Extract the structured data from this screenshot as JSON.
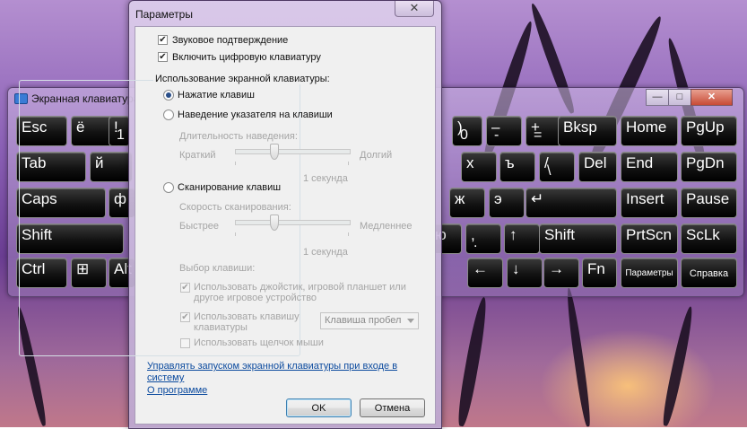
{
  "osk": {
    "title": "Экранная клавиатура",
    "title_buttons": {
      "minimize": "—",
      "maximize": "□",
      "close": "✕"
    },
    "rows": [
      [
        {
          "label": "Esc"
        },
        {
          "label": "ё"
        },
        {
          "label": "!",
          "sub": "1"
        },
        {
          "label": ")",
          "sub": "0"
        },
        {
          "label": "–",
          "sub": "-"
        },
        {
          "label": "+",
          "sub": "="
        },
        {
          "label": "Bksp"
        },
        {
          "label": "Home"
        },
        {
          "label": "PgUp"
        }
      ],
      [
        {
          "label": "Tab"
        },
        {
          "label": "й"
        },
        {
          "label": "х"
        },
        {
          "label": "ъ"
        },
        {
          "label": "/",
          "sub": "\\"
        },
        {
          "label": "Del"
        },
        {
          "label": "End"
        },
        {
          "label": "PgDn"
        }
      ],
      [
        {
          "label": "Caps"
        },
        {
          "label": "ф"
        },
        {
          "label": "ж"
        },
        {
          "label": "э"
        },
        {
          "label": "↵"
        },
        {
          "label": "Insert"
        },
        {
          "label": "Pause"
        }
      ],
      [
        {
          "label": "Shift"
        },
        {
          "label": "ю"
        },
        {
          "label": ",",
          "sub": "."
        },
        {
          "label": "↑"
        },
        {
          "label": "Shift"
        },
        {
          "label": "PrtScn"
        },
        {
          "label": "ScLk"
        }
      ],
      [
        {
          "label": "Ctrl"
        },
        {
          "label": "⊞"
        },
        {
          "label": "Alt"
        },
        {
          "label": "←"
        },
        {
          "label": "↓"
        },
        {
          "label": "→"
        },
        {
          "label": "Fn"
        },
        {
          "label": "Параметры"
        },
        {
          "label": "Справка"
        }
      ]
    ]
  },
  "dialog": {
    "title": "Параметры",
    "close": "✕",
    "sound_confirm": "Звуковое подтверждение",
    "numpad": "Включить цифровую клавиатуру",
    "group_title": "Использование экранной клавиатуры:",
    "mode_click": "Нажатие клавиш",
    "mode_hover": "Наведение указателя на клавиши",
    "hover_duration_label": "Длительность наведения:",
    "hover_short": "Краткий",
    "hover_long": "Долгий",
    "hover_value": "1 секунда",
    "mode_scan": "Сканирование клавиш",
    "scan_speed_label": "Скорость сканирования:",
    "scan_fast": "Быстрее",
    "scan_slow": "Медленнее",
    "scan_value": "1 секунда",
    "key_select_label": "Выбор клавиши:",
    "use_joystick_1": "Использовать джойстик, игровой планшет или",
    "use_joystick_2": "другое игровое устройство",
    "use_key_1": "Использовать клавишу",
    "use_key_2": "клавиатуры",
    "key_combo": "Клавиша пробел",
    "use_mouse": "Использовать щелчок мыши",
    "startup_link_1": "Управлять запуском экранной клавиатуры при входе в",
    "startup_link_2": "систему",
    "about_link": "О программе",
    "ok": "OK",
    "cancel": "Отмена"
  },
  "colors": {
    "accent": "#2a4f8a",
    "link": "#0b4a9e"
  }
}
